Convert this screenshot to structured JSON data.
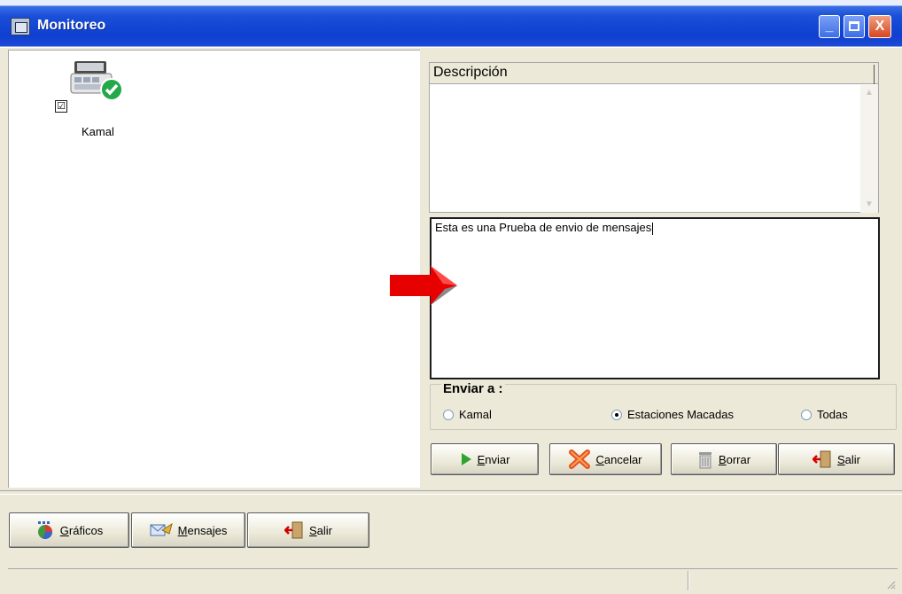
{
  "window": {
    "title": "Monitoreo",
    "controls": {
      "minimize": "_",
      "close": "X"
    }
  },
  "stations": [
    {
      "label": "Kamal",
      "checked": true,
      "check_glyph": "☑",
      "status": "ok",
      "icon": "computer-icon"
    }
  ],
  "grid": {
    "header": "Descripción",
    "rows": []
  },
  "message": {
    "value": "Esta es una Prueba de envio de mensajes"
  },
  "send_to": {
    "title": "Enviar a :",
    "options": [
      {
        "label": "Kamal",
        "selected": false
      },
      {
        "label": "Estaciones Macadas",
        "selected": true
      },
      {
        "label": "Todas",
        "selected": false
      }
    ]
  },
  "actions": [
    {
      "label": "Enviar",
      "accel": "E",
      "rest": "nviar",
      "icon": "play-icon"
    },
    {
      "label": "Cancelar",
      "accel": "C",
      "rest": "ancelar",
      "icon": "cancel-x-icon"
    },
    {
      "label": "Borrar",
      "accel": "B",
      "rest": "orrar",
      "icon": "trash-icon"
    },
    {
      "label": "Salir",
      "accel": "S",
      "rest": "alir",
      "icon": "exit-door-icon"
    }
  ],
  "toolbar": [
    {
      "label": "Gráficos",
      "accel": "G",
      "rest": "ráficos",
      "icon": "chart-icon"
    },
    {
      "label": "Mensajes",
      "accel": "M",
      "rest": "ensajes",
      "icon": "message-icon"
    },
    {
      "label": "Salir",
      "accel": "S",
      "rest": "alir",
      "icon": "exit-door-icon"
    }
  ],
  "colors": {
    "titlebar": "#1a4fd8",
    "face": "#ece9d8",
    "arrow": "#e60000",
    "close": "#d6451f"
  }
}
